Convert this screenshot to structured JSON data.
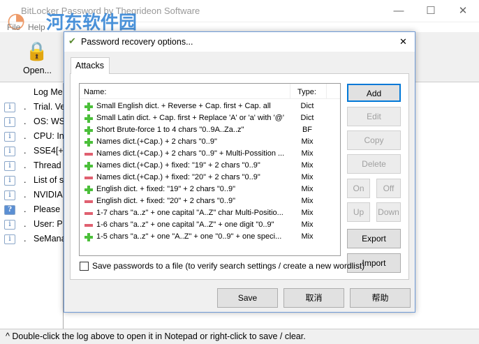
{
  "window": {
    "title": "BitLocker Password by Thegrideon Software",
    "minimize": "—",
    "maximize": "☐",
    "close": "✕"
  },
  "menu": {
    "items": [
      "File",
      "Help"
    ]
  },
  "toolbar": {
    "open_label": "Open..."
  },
  "log": {
    "header": "Log Me",
    "rows": [
      {
        "icon": "info",
        "text": "Trial. Ve"
      },
      {
        "icon": "info",
        "text": "OS: WS"
      },
      {
        "icon": "info",
        "text": "CPU: In"
      },
      {
        "icon": "info",
        "text": "SSE4[+]"
      },
      {
        "icon": "info",
        "text": "Thread"
      },
      {
        "icon": "info",
        "text": "List of s"
      },
      {
        "icon": "info",
        "text": "NVIDIA"
      },
      {
        "icon": "question",
        "text": "Please"
      },
      {
        "icon": "info",
        "text": "User: P"
      },
      {
        "icon": "info",
        "text": "SeMana"
      }
    ]
  },
  "status": "^ Double-click the log above to open it in Notepad or right-click to save / clear.",
  "watermark": {
    "text": "河东软件园",
    "url": "www.pc0359.cn"
  },
  "dialog": {
    "title": "Password recovery options...",
    "close": "✕",
    "tab": "Attacks",
    "list": {
      "col_name": "Name:",
      "col_type": "Type:",
      "rows": [
        {
          "on": true,
          "name": "Small English dict. + Reverse + Cap. first + Cap. all",
          "type": "Dict"
        },
        {
          "on": true,
          "name": "Small Latin dict. + Cap. first + Replace 'A' or 'a' with '@'",
          "type": "Dict"
        },
        {
          "on": true,
          "name": "Short Brute-force 1 to 4 chars \"0..9A..Za..z\"",
          "type": "BF"
        },
        {
          "on": true,
          "name": "Names dict.(+Cap.) + 2 chars \"0..9\"",
          "type": "Mix"
        },
        {
          "on": false,
          "name": "Names dict.(+Cap.) + 2 chars \"0..9\" + Multi-Possition ...",
          "type": "Mix"
        },
        {
          "on": true,
          "name": "Names dict.(+Cap.) + fixed: \"19\" + 2 chars \"0..9\"",
          "type": "Mix"
        },
        {
          "on": false,
          "name": "Names dict.(+Cap.) + fixed: \"20\" + 2 chars \"0..9\"",
          "type": "Mix"
        },
        {
          "on": true,
          "name": "English dict. + fixed: \"19\" + 2 chars \"0..9\"",
          "type": "Mix"
        },
        {
          "on": false,
          "name": "English dict. + fixed: \"20\" + 2 chars \"0..9\"",
          "type": "Mix"
        },
        {
          "on": false,
          "name": "1-7 chars \"a..z\" + one capital \"A..Z\" char Multi-Positio...",
          "type": "Mix"
        },
        {
          "on": false,
          "name": "1-6 chars \"a..z\" + one capital \"A..Z\" + one digit \"0..9\"",
          "type": "Mix"
        },
        {
          "on": true,
          "name": "1-5 chars \"a..z\" + one \"A..Z\" + one \"0..9\" + one speci...",
          "type": "Mix"
        }
      ]
    },
    "buttons": {
      "add": "Add",
      "edit": "Edit",
      "copy": "Copy",
      "delete": "Delete",
      "on": "On",
      "off": "Off",
      "up": "Up",
      "down": "Down",
      "export": "Export",
      "import": "Import"
    },
    "save_checkbox": {
      "label": "Save passwords to a file (to verify search settings / create a new wordlist)",
      "checked": false
    },
    "footer": {
      "save": "Save",
      "cancel": "取消",
      "help": "帮助"
    }
  }
}
